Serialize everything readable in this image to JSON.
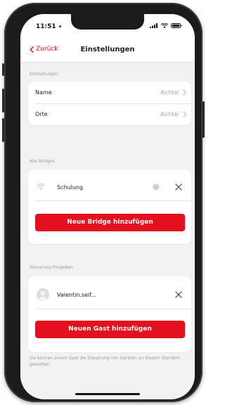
{
  "status_bar": {
    "time": "11:51"
  },
  "nav": {
    "back_label": "Zurück",
    "title": "Einstellungen"
  },
  "settings_section": {
    "label": "Einstellungen",
    "rows": [
      {
        "label": "Name",
        "value": "Aichtal"
      },
      {
        "label": "Orte",
        "value": "Aichtal"
      }
    ]
  },
  "bridges_section": {
    "label": "Alle Bridges",
    "bridges": [
      {
        "name": "Schulung"
      }
    ],
    "add_button_label": "Neue Bridge hinzufügen"
  },
  "share_section": {
    "label": "Steuerung freigeben",
    "guests": [
      {
        "name": "Valentin.seif..."
      }
    ],
    "add_button_label": "Neuen Gast hinzufügen",
    "footer_note": "Sie können einem Gast die Steuerung von Geräten an diesem Standort gestatten"
  },
  "colors": {
    "accent": "#e3101d",
    "background": "#f2f2f4",
    "secondary_text": "#9a9a9f"
  }
}
